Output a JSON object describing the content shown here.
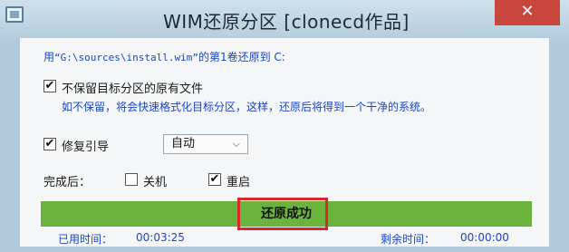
{
  "window": {
    "title": "WIM还原分区  [clonecd作品]",
    "close_label": "✕"
  },
  "source": {
    "prefix": "用",
    "path": "“G:\\sources\\install.wim”",
    "suffix": "的第1卷还原到 C:"
  },
  "options": {
    "keep_files_label": "不保留目标分区的原有文件",
    "keep_files_checked": true,
    "keep_files_note": "如不保留，将会快速格式化目标分区，这样，还原后将得到一个干净的系统。",
    "repair_boot_label": "修复引导",
    "repair_boot_checked": true,
    "repair_mode_selected": "自动"
  },
  "after_complete": {
    "label": "完成后：",
    "shutdown_label": "关机",
    "shutdown_checked": false,
    "restart_label": "重启",
    "restart_checked": true
  },
  "progress": {
    "fraction": 1.0,
    "status_text": "还原成功",
    "status_color": "#6ab43e"
  },
  "timing": {
    "elapsed_label": "已用时间：",
    "elapsed_value": "00:03:25",
    "remaining_label": "剩余时间：",
    "remaining_value": "00:00:00"
  },
  "colors": {
    "accent_text": "#1d45c8",
    "highlight_border": "#d8282c"
  }
}
